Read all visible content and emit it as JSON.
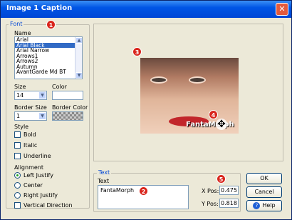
{
  "window": {
    "title": "Image 1 Caption",
    "close_glyph": "✕"
  },
  "font_group": {
    "legend": "Font",
    "name_label": "Name",
    "fonts": [
      "Arial",
      "Arial Black",
      "Arial Narrow",
      "Arrows1",
      "Arrows2",
      "Autumn",
      "AvantGarde Md BT"
    ],
    "selected_font": "Arial Black",
    "size_label": "Size",
    "size_value": "14",
    "color_label": "Color",
    "color_value": "#ffffff",
    "border_size_label": "Border Size",
    "border_size_value": "1",
    "border_color_label": "Border Color",
    "style_label": "Style",
    "styles": [
      {
        "label": "Bold",
        "checked": false
      },
      {
        "label": "Italic",
        "checked": false
      },
      {
        "label": "Underline",
        "checked": false
      }
    ],
    "alignment_label": "Alignment",
    "alignments": [
      {
        "label": "Left Justify",
        "selected": true
      },
      {
        "label": "Center",
        "selected": false
      },
      {
        "label": "Right Justify",
        "selected": false
      }
    ],
    "vertical_label": "Vertical Direction",
    "vertical_checked": false
  },
  "preview": {
    "caption": "FantaMorph"
  },
  "text_group": {
    "legend": "Text",
    "text_label": "Text",
    "text_value": "FantaMorph",
    "xpos_label": "X Pos:",
    "xpos_value": "0.475",
    "ypos_label": "Y Pos:",
    "ypos_value": "0.818"
  },
  "buttons": {
    "ok": "OK",
    "cancel": "Cancel",
    "help": "Help"
  },
  "badges": [
    "1",
    "2",
    "3",
    "4",
    "5"
  ],
  "colors": {
    "badge": "#d9251c",
    "title_bar": "#0055e5",
    "selection": "#316ac5"
  }
}
